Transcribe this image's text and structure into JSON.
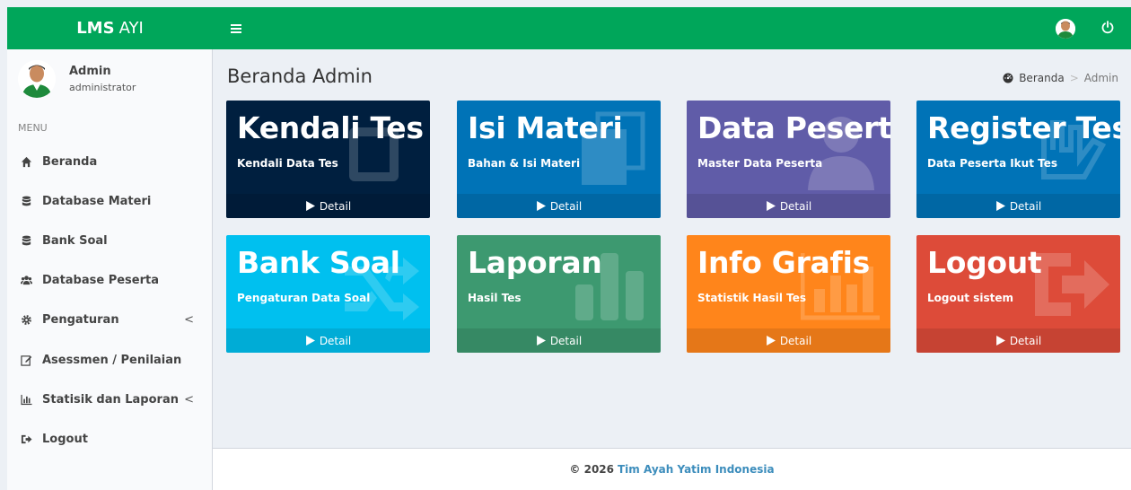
{
  "header": {
    "logo_bold": "LMS",
    "logo_light": "AYI",
    "brand_color": "#00a65a"
  },
  "user": {
    "name": "Admin",
    "role": "administrator"
  },
  "sidebar": {
    "menu_header": "MENU",
    "items": [
      {
        "label": "Beranda",
        "icon": "home-icon"
      },
      {
        "label": "Database Materi",
        "icon": "database-icon"
      },
      {
        "label": "Bank Soal",
        "icon": "database-icon"
      },
      {
        "label": "Database Peserta",
        "icon": "users-icon"
      },
      {
        "label": "Pengaturan",
        "icon": "gear-icon",
        "chevron": "<"
      },
      {
        "label": "Asessmen / Penilaian",
        "icon": "edit-icon"
      },
      {
        "label": "Statisik dan Laporan",
        "icon": "bar-chart-icon",
        "chevron": "<"
      },
      {
        "label": "Logout",
        "icon": "sign-out-icon"
      }
    ]
  },
  "content": {
    "title": "Beranda Admin",
    "breadcrumb": {
      "home": "Beranda",
      "separator": ">",
      "current": "Admin"
    }
  },
  "tiles": [
    {
      "title": "Kendali Tes",
      "subtitle": "Kendali Data Tes",
      "detail": "Detail",
      "color": "#001f3f",
      "icon": "square-icon"
    },
    {
      "title": "Isi Materi",
      "subtitle": "Bahan & Isi Materi",
      "detail": "Detail",
      "color": "#0073b7",
      "icon": "copy-icon"
    },
    {
      "title": "Data Peserta",
      "subtitle": "Master Data Peserta",
      "detail": "Detail",
      "color": "#605ca8",
      "icon": "user-icon"
    },
    {
      "title": "Register Tes",
      "subtitle": "Data Peserta Ikut Tes",
      "detail": "Detail",
      "color": "#0073b7",
      "icon": "hand-icon"
    },
    {
      "title": "Bank Soal",
      "subtitle": "Pengaturan Data Soal",
      "detail": "Detail",
      "color": "#00c0ef",
      "icon": "shuffle-icon"
    },
    {
      "title": "Laporan",
      "subtitle": "Hasil Tes",
      "detail": "Detail",
      "color": "#3d9970",
      "icon": "bar-chart-icon"
    },
    {
      "title": "Info Grafis",
      "subtitle": "Statistik Hasil Tes",
      "detail": "Detail",
      "color": "#ff851b",
      "icon": "area-chart-icon"
    },
    {
      "title": "Logout",
      "subtitle": "Logout sistem",
      "detail": "Detail",
      "color": "#dd4b39",
      "icon": "sign-out-icon"
    }
  ],
  "footer": {
    "copyright": "© 2026",
    "link_text": "Tim Ayah Yatim Indonesia",
    "link_color": "#3c8dbc"
  }
}
